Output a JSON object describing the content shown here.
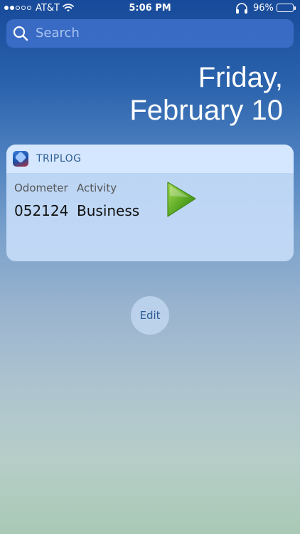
{
  "status_bar": {
    "carrier": "AT&T",
    "time": "5:06 PM",
    "battery": "96%",
    "battery_fraction": 0.96,
    "signal_bars_filled": 2,
    "signal_bars_total": 5,
    "icons": [
      "signal-dots-icon",
      "wifi-icon",
      "headphones-icon",
      "battery-icon"
    ]
  },
  "search": {
    "placeholder": "Search",
    "icon": "search-icon"
  },
  "date": {
    "line1": "Friday,",
    "line2": "February 10"
  },
  "widget": {
    "app_name": "TRIPLOG",
    "app_icon": "triplog-app-icon",
    "odometer_label": "Odometer",
    "odometer_value": "052124",
    "activity_label": "Activity",
    "activity_value": "Business",
    "action_icon": "play-icon",
    "action_color": "#5aa824"
  },
  "edit_button": {
    "label": "Edit"
  },
  "colors": {
    "accent": "#2f5d93",
    "search_bg": "#3c6ec8"
  }
}
